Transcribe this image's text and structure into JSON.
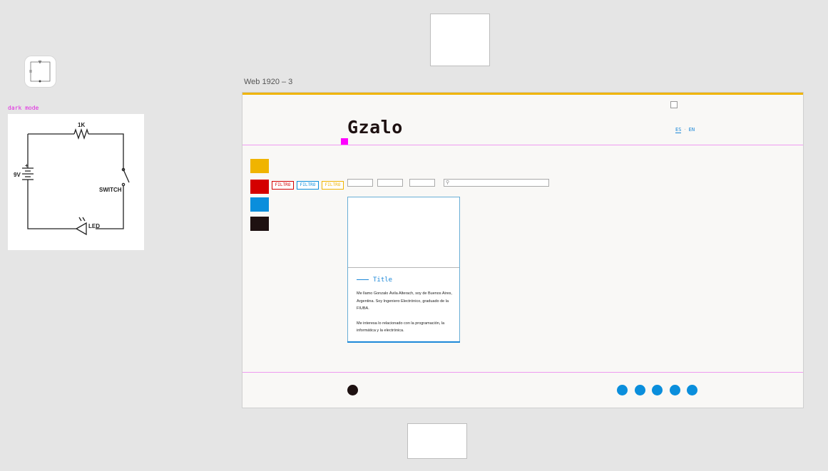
{
  "frame": {
    "title": "Web 1920 – 3"
  },
  "artboard_label": "dark mode",
  "circuit": {
    "resistor_label": "1K",
    "battery_label": "9V",
    "battery_plus": "+",
    "switch_label": "SWITCH",
    "led_label": "LED"
  },
  "header": {
    "brand": "Gzalo",
    "lang_es": "ES",
    "lang_sep": "·",
    "lang_en": "EN"
  },
  "colors": {
    "yellow": "#f0b400",
    "red": "#d40000",
    "blue": "#0a8edc",
    "dark": "#1e1111",
    "guide": "#ee9af0"
  },
  "filters": [
    "FILTRO",
    "FILTRO",
    "FILTRO"
  ],
  "card": {
    "title": "Title",
    "paragraph1": "Me llamo Gonzalo Ávila Alterach, soy de Buenos Aires, Argentina. Soy Ingeniero Electrónico, graduado de la FIUBA.",
    "paragraph2": "Me interesa lo relacionado con la programación, la informática y la electrónica."
  },
  "search": {
    "icon": "search-icon"
  }
}
